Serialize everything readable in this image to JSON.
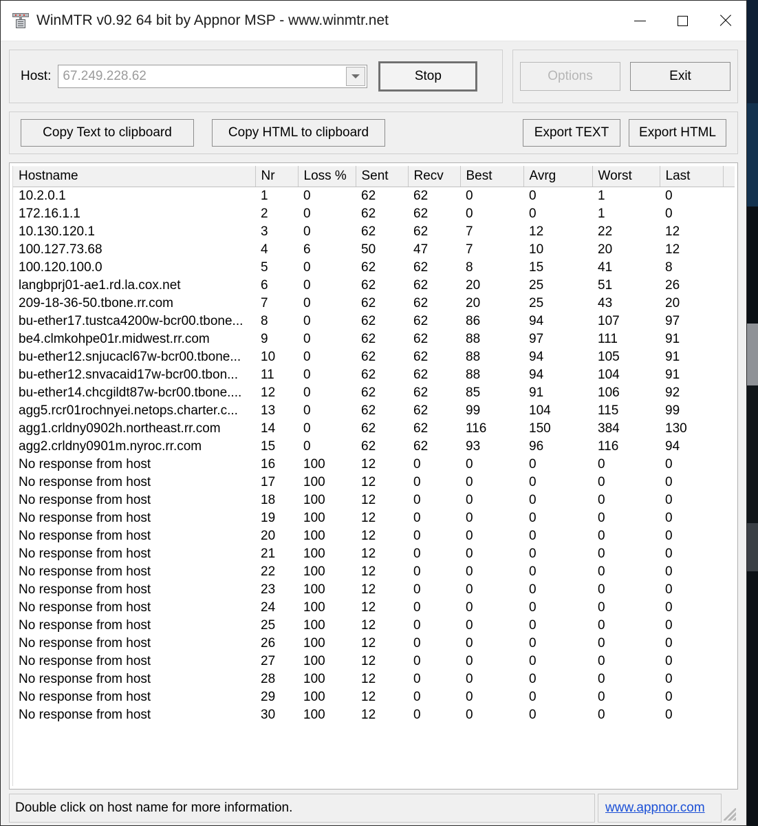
{
  "window": {
    "title": "WinMTR v0.92 64 bit by Appnor MSP - www.winmtr.net",
    "icon": "network-device-icon",
    "controls": {
      "minimize": "minimize-icon",
      "maximize": "maximize-icon",
      "close": "close-icon"
    }
  },
  "toolbar": {
    "host_label": "Host:",
    "host_value": "67.249.228.62",
    "host_placeholder": "67.249.228.62",
    "start_stop_label": "Stop",
    "options_label": "Options",
    "exit_label": "Exit",
    "copy_text_label": "Copy Text to clipboard",
    "copy_html_label": "Copy HTML to clipboard",
    "export_text_label": "Export TEXT",
    "export_html_label": "Export HTML"
  },
  "table": {
    "columns": [
      "Hostname",
      "Nr",
      "Loss %",
      "Sent",
      "Recv",
      "Best",
      "Avrg",
      "Worst",
      "Last",
      ""
    ],
    "rows": [
      [
        "10.2.0.1",
        "1",
        "0",
        "62",
        "62",
        "0",
        "0",
        "1",
        "0",
        ""
      ],
      [
        "172.16.1.1",
        "2",
        "0",
        "62",
        "62",
        "0",
        "0",
        "1",
        "0",
        ""
      ],
      [
        "10.130.120.1",
        "3",
        "0",
        "62",
        "62",
        "7",
        "12",
        "22",
        "12",
        ""
      ],
      [
        "100.127.73.68",
        "4",
        "6",
        "50",
        "47",
        "7",
        "10",
        "20",
        "12",
        ""
      ],
      [
        "100.120.100.0",
        "5",
        "0",
        "62",
        "62",
        "8",
        "15",
        "41",
        "8",
        ""
      ],
      [
        "langbprj01-ae1.rd.la.cox.net",
        "6",
        "0",
        "62",
        "62",
        "20",
        "25",
        "51",
        "26",
        ""
      ],
      [
        "209-18-36-50.tbone.rr.com",
        "7",
        "0",
        "62",
        "62",
        "20",
        "25",
        "43",
        "20",
        ""
      ],
      [
        "bu-ether17.tustca4200w-bcr00.tbone...",
        "8",
        "0",
        "62",
        "62",
        "86",
        "94",
        "107",
        "97",
        ""
      ],
      [
        "be4.clmkohpe01r.midwest.rr.com",
        "9",
        "0",
        "62",
        "62",
        "88",
        "97",
        "111",
        "91",
        ""
      ],
      [
        "bu-ether12.snjucacl67w-bcr00.tbone...",
        "10",
        "0",
        "62",
        "62",
        "88",
        "94",
        "105",
        "91",
        ""
      ],
      [
        "bu-ether12.snvacaid17w-bcr00.tbon...",
        "11",
        "0",
        "62",
        "62",
        "88",
        "94",
        "104",
        "91",
        ""
      ],
      [
        "bu-ether14.chcgildt87w-bcr00.tbone....",
        "12",
        "0",
        "62",
        "62",
        "85",
        "91",
        "106",
        "92",
        ""
      ],
      [
        "agg5.rcr01rochnyei.netops.charter.c...",
        "13",
        "0",
        "62",
        "62",
        "99",
        "104",
        "115",
        "99",
        ""
      ],
      [
        "agg1.crldny0902h.northeast.rr.com",
        "14",
        "0",
        "62",
        "62",
        "116",
        "150",
        "384",
        "130",
        ""
      ],
      [
        "agg2.crldny0901m.nyroc.rr.com",
        "15",
        "0",
        "62",
        "62",
        "93",
        "96",
        "116",
        "94",
        ""
      ],
      [
        "No response from host",
        "16",
        "100",
        "12",
        "0",
        "0",
        "0",
        "0",
        "0",
        ""
      ],
      [
        "No response from host",
        "17",
        "100",
        "12",
        "0",
        "0",
        "0",
        "0",
        "0",
        ""
      ],
      [
        "No response from host",
        "18",
        "100",
        "12",
        "0",
        "0",
        "0",
        "0",
        "0",
        ""
      ],
      [
        "No response from host",
        "19",
        "100",
        "12",
        "0",
        "0",
        "0",
        "0",
        "0",
        ""
      ],
      [
        "No response from host",
        "20",
        "100",
        "12",
        "0",
        "0",
        "0",
        "0",
        "0",
        ""
      ],
      [
        "No response from host",
        "21",
        "100",
        "12",
        "0",
        "0",
        "0",
        "0",
        "0",
        ""
      ],
      [
        "No response from host",
        "22",
        "100",
        "12",
        "0",
        "0",
        "0",
        "0",
        "0",
        ""
      ],
      [
        "No response from host",
        "23",
        "100",
        "12",
        "0",
        "0",
        "0",
        "0",
        "0",
        ""
      ],
      [
        "No response from host",
        "24",
        "100",
        "12",
        "0",
        "0",
        "0",
        "0",
        "0",
        ""
      ],
      [
        "No response from host",
        "25",
        "100",
        "12",
        "0",
        "0",
        "0",
        "0",
        "0",
        ""
      ],
      [
        "No response from host",
        "26",
        "100",
        "12",
        "0",
        "0",
        "0",
        "0",
        "0",
        ""
      ],
      [
        "No response from host",
        "27",
        "100",
        "12",
        "0",
        "0",
        "0",
        "0",
        "0",
        ""
      ],
      [
        "No response from host",
        "28",
        "100",
        "12",
        "0",
        "0",
        "0",
        "0",
        "0",
        ""
      ],
      [
        "No response from host",
        "29",
        "100",
        "12",
        "0",
        "0",
        "0",
        "0",
        "0",
        ""
      ],
      [
        "No response from host",
        "30",
        "100",
        "12",
        "0",
        "0",
        "0",
        "0",
        "0",
        ""
      ]
    ]
  },
  "statusbar": {
    "hint": "Double click on host name for more information.",
    "link": "www.appnor.com"
  },
  "colors": {
    "window_bg": "#f0f0f0",
    "list_bg": "#ffffff",
    "header_bg": "#f1f1f1",
    "text": "#000000",
    "disabled_text": "#b6b6b6",
    "link": "#1a4fd6"
  }
}
